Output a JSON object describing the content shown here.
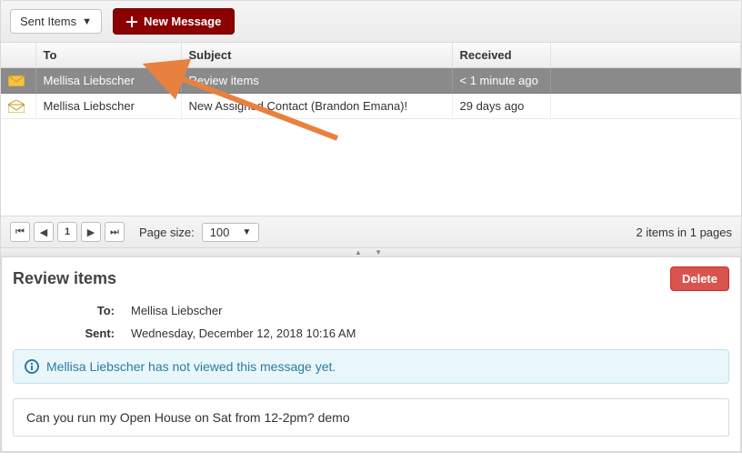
{
  "toolbar": {
    "folder_selected": "Sent Items",
    "new_msg_label": "New Message"
  },
  "columns": {
    "to": "To",
    "subject": "Subject",
    "received": "Received"
  },
  "rows": [
    {
      "to": "Mellisa Liebscher",
      "subject": "Review items",
      "received": "< 1 minute ago",
      "selected": true,
      "icon": "closed"
    },
    {
      "to": "Mellisa Liebscher",
      "subject": "New Assigned Contact (Brandon Emana)!",
      "received": "29 days ago",
      "selected": false,
      "icon": "open"
    }
  ],
  "pager": {
    "page_size_label": "Page size:",
    "page_size_value": "100",
    "current_page": "1",
    "summary": "2 items in 1 pages"
  },
  "detail": {
    "title": "Review items",
    "to_label": "To:",
    "to_value": "Mellisa Liebscher",
    "sent_label": "Sent:",
    "sent_value": "Wednesday, December 12, 2018 10:16 AM",
    "delete_label": "Delete",
    "alert_text": "Mellisa Liebscher has not viewed this message yet.",
    "body": "Can you run my Open House on Sat from 12-2pm? demo"
  }
}
